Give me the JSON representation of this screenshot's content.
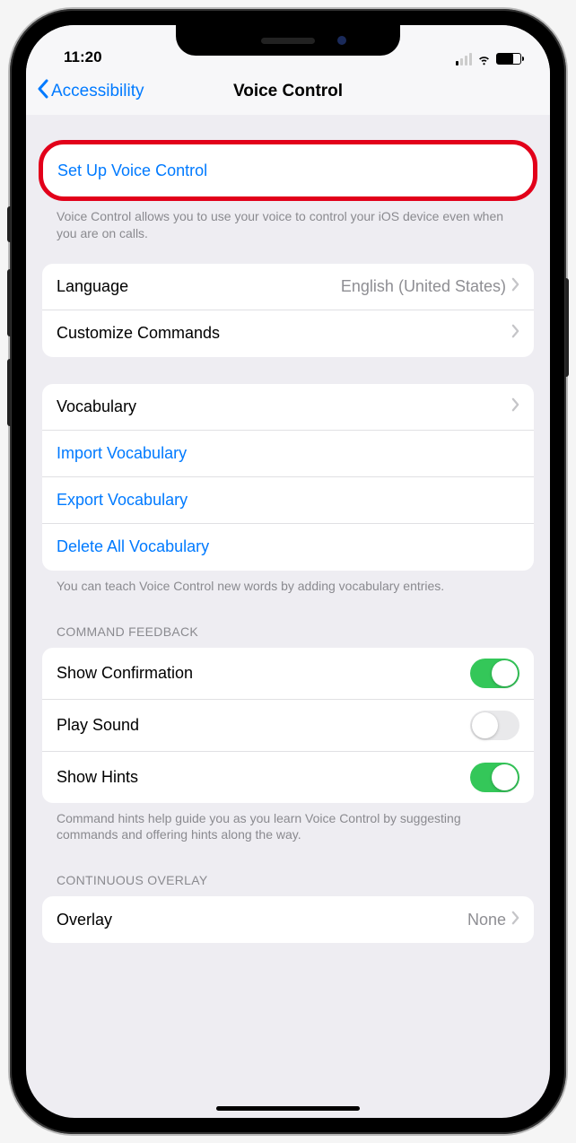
{
  "status": {
    "time": "11:20"
  },
  "nav": {
    "back_label": "Accessibility",
    "title": "Voice Control"
  },
  "setup": {
    "label": "Set Up Voice Control",
    "footer": "Voice Control allows you to use your voice to control your iOS device even when you are on calls."
  },
  "lang_group": {
    "language_label": "Language",
    "language_value": "English (United States)",
    "customize_label": "Customize Commands"
  },
  "vocab_group": {
    "vocabulary_label": "Vocabulary",
    "import_label": "Import Vocabulary",
    "export_label": "Export Vocabulary",
    "delete_label": "Delete All Vocabulary",
    "footer": "You can teach Voice Control new words by adding vocabulary entries."
  },
  "feedback_group": {
    "header": "Command Feedback",
    "show_confirmation_label": "Show Confirmation",
    "show_confirmation_on": true,
    "play_sound_label": "Play Sound",
    "play_sound_on": false,
    "show_hints_label": "Show Hints",
    "show_hints_on": true,
    "footer": "Command hints help guide you as you learn Voice Control by suggesting commands and offering hints along the way."
  },
  "overlay_group": {
    "header": "Continuous Overlay",
    "overlay_label": "Overlay",
    "overlay_value": "None"
  }
}
